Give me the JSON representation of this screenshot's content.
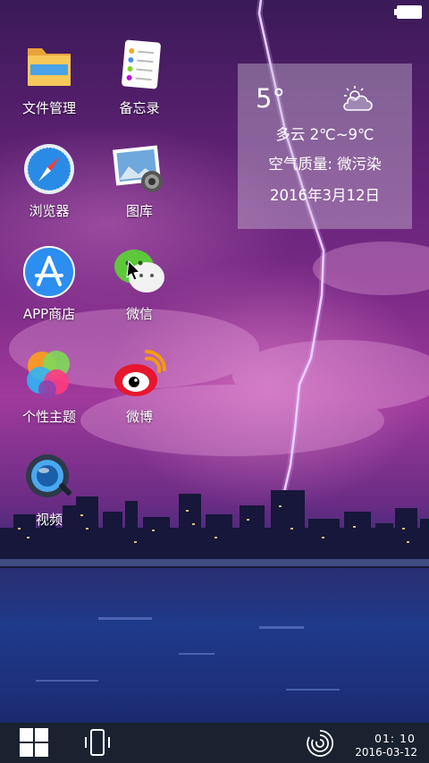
{
  "apps": [
    {
      "label": "文件管理",
      "icon": "folder-icon"
    },
    {
      "label": "备忘录",
      "icon": "notes-icon"
    },
    {
      "label": "浏览器",
      "icon": "browser-compass-icon"
    },
    {
      "label": "图库",
      "icon": "gallery-icon"
    },
    {
      "label": "APP商店",
      "icon": "app-store-icon"
    },
    {
      "label": "微信",
      "icon": "wechat-icon"
    },
    {
      "label": "个性主题",
      "icon": "theme-icon"
    },
    {
      "label": "微博",
      "icon": "weibo-icon"
    },
    {
      "label": "视频",
      "icon": "video-icon"
    }
  ],
  "weather": {
    "temperature": "5°",
    "condition_range": "多云   2℃~9℃",
    "air_quality": "空气质量: 微污染",
    "date": "2016年3月12日",
    "icon": "partly-cloudy-icon"
  },
  "taskbar": {
    "time": "01: 10",
    "date": "2016-03-12",
    "start_icon": "windows-start-icon",
    "phone_icon": "phone-icon",
    "spinner_icon": "spinner-icon"
  },
  "status": {
    "battery_icon": "battery-icon"
  },
  "colors": {
    "taskbar": "#1a2230",
    "widget": "#cdbed7"
  }
}
